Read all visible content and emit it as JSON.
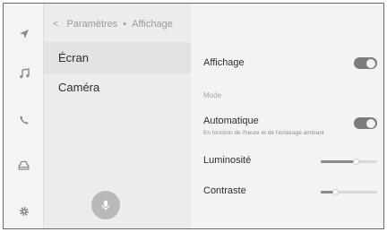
{
  "nav_rail": {
    "icons": [
      "navigation-arrow-icon",
      "music-note-icon",
      "phone-icon",
      "car-icon",
      "settings-gear-icon"
    ]
  },
  "breadcrumb": {
    "back_glyph": "<",
    "parent": "Paramètres",
    "separator": "•",
    "current": "Affichage"
  },
  "menu": {
    "items": [
      {
        "label": "Écran",
        "selected": true
      },
      {
        "label": "Caméra",
        "selected": false
      }
    ]
  },
  "voice_button": {
    "icon": "microphone-icon"
  },
  "settings": {
    "display": {
      "label": "Affichage",
      "on": true
    },
    "section_title": "Mode",
    "automatic": {
      "label": "Automatique",
      "description": "En fonction de l'heure et de l'éclairage ambiant",
      "on": true
    },
    "brightness": {
      "label": "Luminosité",
      "level": 0.62
    },
    "contrast": {
      "label": "Contraste",
      "level": 0.25
    }
  },
  "colors": {
    "toggle_on": "#7c7c7c",
    "slider_fill": "#8a8a8a",
    "selected_item": "#e2e2e2"
  }
}
